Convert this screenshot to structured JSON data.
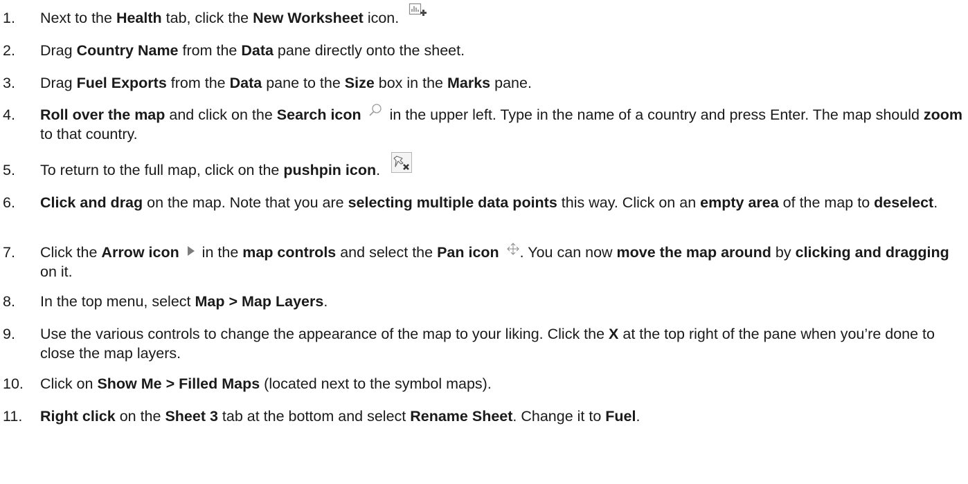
{
  "steps": [
    {
      "num": "1.",
      "t": [
        "Next to the ",
        "Health",
        " tab, click the ",
        "New Worksheet",
        " icon."
      ]
    },
    {
      "num": "2.",
      "t": [
        "Drag ",
        "Country Name",
        " from the ",
        "Data",
        " pane directly onto the sheet."
      ]
    },
    {
      "num": "3.",
      "t": [
        "Drag ",
        "Fuel Exports",
        " from the ",
        "Data",
        " pane to the ",
        "Size",
        " box in the ",
        "Marks",
        " pane."
      ]
    },
    {
      "num": "4.",
      "t": [
        "Roll over the map",
        " and click on the ",
        "Search icon",
        " in the upper left. Type in the name of a country and press Enter. The map should ",
        "zoom",
        " to that country."
      ]
    },
    {
      "num": "5.",
      "t": [
        "To return to the full map, click on the ",
        "pushpin icon",
        "."
      ]
    },
    {
      "num": "6.",
      "t": [
        "Click and drag",
        " on the map. Note that you are ",
        "selecting multiple data points",
        " this way. Click on an ",
        "empty area",
        " of the map to ",
        "deselect",
        "."
      ]
    },
    {
      "num": "7.",
      "t": [
        "Click the ",
        "Arrow icon",
        " in the ",
        "map controls",
        " and select the ",
        "Pan icon",
        ". You can now ",
        "move the map around",
        " by ",
        "clicking and dragging",
        " on it."
      ]
    },
    {
      "num": "8.",
      "t": [
        "In the top menu, select ",
        "Map > Map Layers",
        "."
      ]
    },
    {
      "num": "9.",
      "t": [
        "Use the various controls to change the appearance of the map to your liking. Click the ",
        "X",
        " at the top right of the pane when you’re done to close the map layers."
      ]
    },
    {
      "num": "10.",
      "t": [
        "Click on ",
        "Show Me > Filled Maps",
        " (located next to the symbol maps)."
      ]
    },
    {
      "num": "11.",
      "t": [
        "Right click",
        " on the ",
        "Sheet 3",
        " tab at the bottom and select ",
        "Rename Sheet",
        ". Change it to ",
        "Fuel",
        "."
      ]
    }
  ],
  "icons": {
    "new_worksheet": "new-worksheet-icon",
    "search": "search-icon",
    "pushpin": "pushpin-reset-icon",
    "arrow": "arrow-icon",
    "pan": "pan-icon"
  }
}
